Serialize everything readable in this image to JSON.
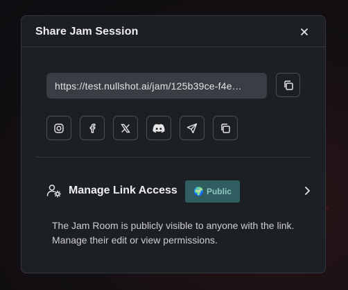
{
  "modal": {
    "title": "Share Jam Session"
  },
  "link": {
    "value": "https://test.nullshot.ai/jam/125b39ce-f4e…"
  },
  "share_buttons": [
    {
      "icon": "instagram-icon"
    },
    {
      "icon": "facebook-icon"
    },
    {
      "icon": "x-twitter-icon"
    },
    {
      "icon": "discord-icon"
    },
    {
      "icon": "telegram-icon"
    },
    {
      "icon": "copy-icon"
    }
  ],
  "access": {
    "label": "Manage Link Access",
    "badge": "Public",
    "badge_emoji": "🌍",
    "description": "The Jam Room is publicly visible to anyone with the link. Manage their edit or view permissions."
  },
  "colors": {
    "modal_bg": "#1c1f23",
    "badge_bg": "#2f5d60",
    "badge_text": "#8fc7c3"
  }
}
